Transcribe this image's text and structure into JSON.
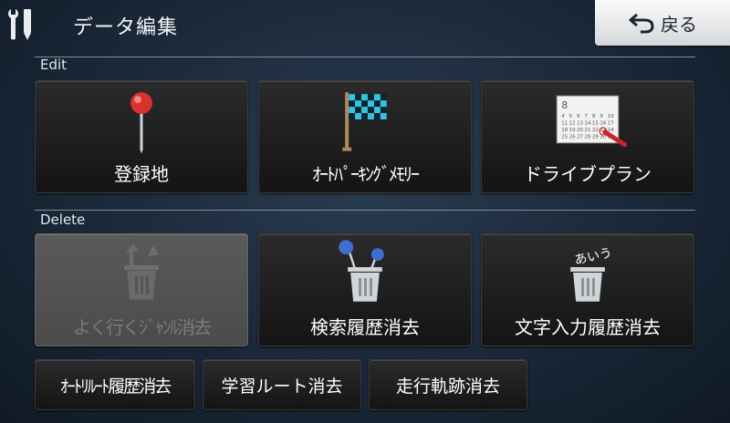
{
  "header": {
    "icon": "tools-icon",
    "title": "データ編集",
    "back_label": "戻る",
    "back_icon": "back-arrow-icon"
  },
  "sections": {
    "edit_label": "Edit",
    "delete_label": "Delete"
  },
  "edit_tiles": [
    {
      "label": "登録地",
      "icon": "map-pin-icon",
      "enabled": true
    },
    {
      "label": "ｵｰﾄﾊﾟｰｷﾝｸﾞﾒﾓﾘｰ",
      "icon": "checkered-flag-icon",
      "enabled": true
    },
    {
      "label": "ドライブプラン",
      "icon": "calendar-icon",
      "enabled": true
    }
  ],
  "calendar_icon_text": {
    "month": "8",
    "dates": [
      "4",
      "5",
      "6",
      "7",
      "8",
      "9",
      "10",
      "11",
      "12",
      "13",
      "14",
      "15",
      "16",
      "17",
      "18",
      "19",
      "20",
      "21",
      "22",
      "23",
      "24",
      "25",
      "26",
      "27",
      "28",
      "29",
      "30",
      "31"
    ]
  },
  "delete_tiles": [
    {
      "label": "よく行くｼﾞｬﾝﾙ消去",
      "icon": "trash-flag-icon",
      "enabled": false
    },
    {
      "label": "検索履歴消去",
      "icon": "trash-pins-icon",
      "enabled": true
    },
    {
      "label": "文字入力履歴消去",
      "icon": "trash-text-icon",
      "enabled": true,
      "icon_text": "あいう"
    }
  ],
  "small_buttons": [
    {
      "label": "ｵｰﾄﾘﾙｰﾄ履歴消去"
    },
    {
      "label": "学習ルート消去"
    },
    {
      "label": "走行軌跡消去"
    }
  ],
  "colors": {
    "pin_red": "#d9322e",
    "pin_blue": "#3e6fd0",
    "flag_cyan": "#35c3e0",
    "trash_light": "#cfd5d8",
    "disabled_gray": "#7a7a7a"
  }
}
